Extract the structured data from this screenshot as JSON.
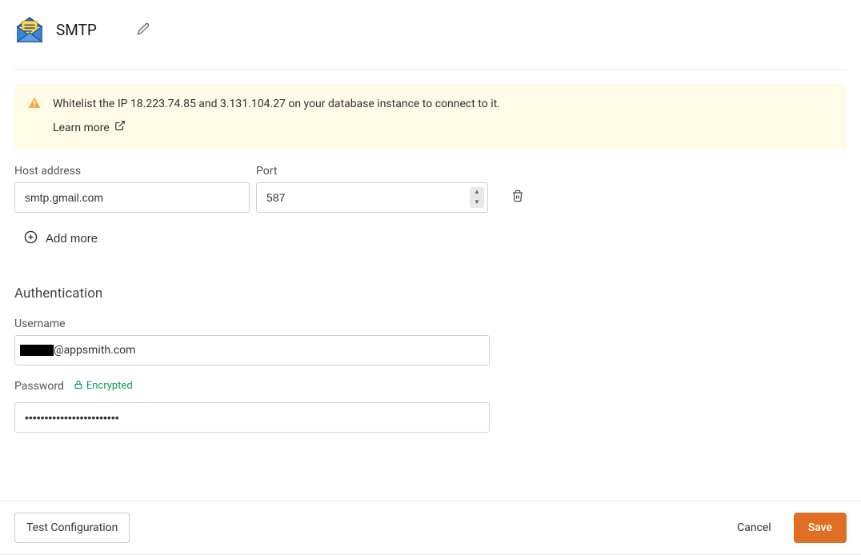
{
  "header": {
    "title": "SMTP"
  },
  "callout": {
    "text": "Whitelist the IP 18.223.74.85 and 3.131.104.27 on your database instance to connect to it.",
    "link_label": "Learn more"
  },
  "fields": {
    "host_label": "Host address",
    "host_value": "smtp.gmail.com",
    "port_label": "Port",
    "port_value": "587",
    "add_more_label": "Add more"
  },
  "auth": {
    "section_heading": "Authentication",
    "username_label": "Username",
    "username_suffix": "@appsmith.com",
    "password_label": "Password",
    "encrypted_label": "Encrypted",
    "password_value": "••••••••••••••••••••••••"
  },
  "footer": {
    "test_label": "Test Configuration",
    "cancel_label": "Cancel",
    "save_label": "Save"
  }
}
